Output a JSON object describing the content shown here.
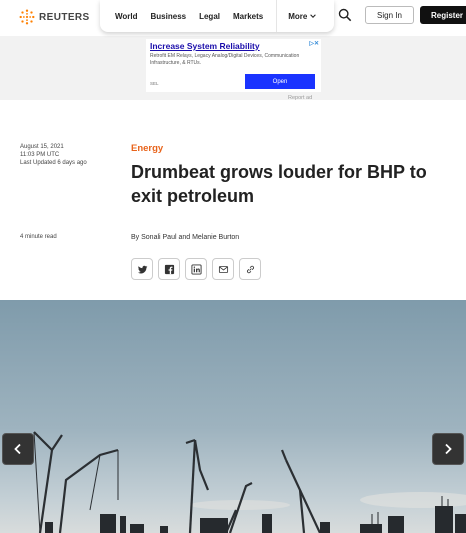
{
  "header": {
    "brand": "REUTERS",
    "nav": [
      "World",
      "Business",
      "Legal",
      "Markets"
    ],
    "more_label": "More",
    "sign_in_label": "Sign In",
    "register_label": "Register"
  },
  "ad": {
    "title": "Increase System Reliability",
    "text": "Retrofit EM Relays, Legacy Analog/Digital Devices, Communication Infrastructure, & RTUs.",
    "sponsor": "SEL",
    "open_label": "Open",
    "report_label": "Report ad"
  },
  "article": {
    "date": "August 15, 2021",
    "time": "11:03 PM UTC",
    "updated": "Last Updated 6 days ago",
    "read_time": "4 minute read",
    "section": "Energy",
    "headline": "Drumbeat grows louder for BHP to exit petroleum",
    "byline": "By Sonali Paul and Melanie Burton"
  },
  "share_icons": [
    "twitter-icon",
    "facebook-icon",
    "linkedin-icon",
    "email-icon",
    "link-icon"
  ],
  "colors": {
    "accent": "#e8641c",
    "ad_link": "#1a0dab",
    "ad_button": "#1a33ff",
    "register_bg": "#111111"
  }
}
